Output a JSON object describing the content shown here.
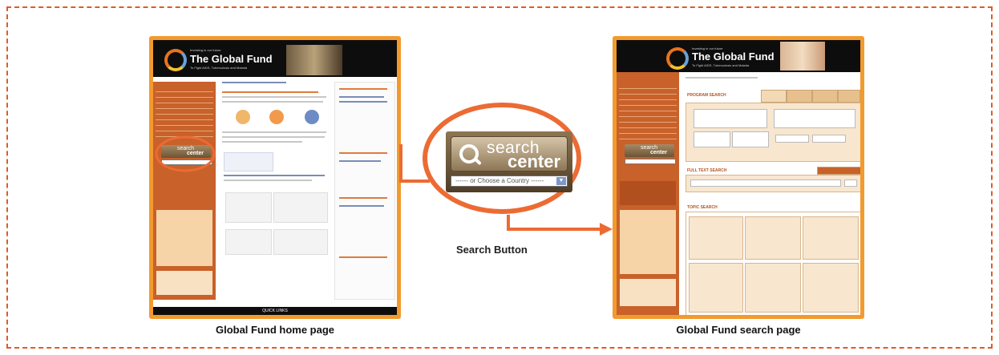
{
  "figure": {
    "colors": {
      "frame": "#e05a2a",
      "accent": "#ec6b33",
      "sidebar": "#c8612a",
      "header": "#0d0d0d"
    }
  },
  "home": {
    "caption": "Global Fund home page",
    "logo_title": "The Global Fund",
    "logo_tagline": "Investing in our future",
    "logo_sub": "To Fight AIDS, Tuberculosis and Malaria",
    "footer": "QUICK LINKS",
    "search_word1": "search",
    "search_word2": "center"
  },
  "search_page": {
    "caption": "Global Fund search page",
    "logo_title": "The Global Fund",
    "logo_tagline": "Investing in our future",
    "logo_sub": "To Fight AIDS, Tuberculosis and Malaria",
    "heading_program": "PROGRAM SEARCH",
    "heading_fulltext": "FULL TEXT SEARCH",
    "heading_topic": "TOPIC SEARCH",
    "search_word1": "search",
    "search_word2": "center"
  },
  "zoom": {
    "search_word1": "search",
    "search_word2": "center",
    "dropdown_text": "------ or Choose a Country ------",
    "dropdown_arrow": "▼",
    "label": "Search Button"
  }
}
